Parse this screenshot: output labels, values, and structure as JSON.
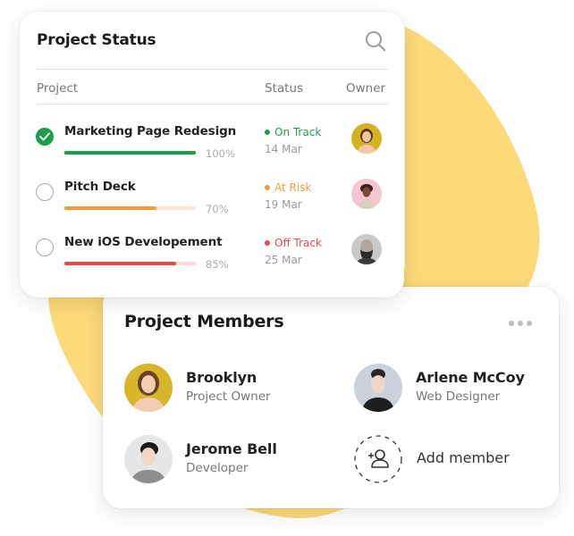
{
  "colors": {
    "blob": "#fcd979",
    "on_track": "#1e9e4a",
    "at_risk": "#f39a3e",
    "off_track": "#e8474d"
  },
  "status_card": {
    "title": "Project Status",
    "search_icon": "search-icon",
    "columns": {
      "project": "Project",
      "status": "Status",
      "owner": "Owner"
    },
    "rows": [
      {
        "name": "Marketing Page Redesign",
        "completed": true,
        "progress": 100,
        "progress_label": "100%",
        "status": "On Track",
        "status_key": "on_track",
        "date": "14 Mar",
        "owner_avatar": "avatar-woman-yellow-bg"
      },
      {
        "name": "Pitch Deck",
        "completed": false,
        "progress": 70,
        "progress_label": "70%",
        "status": "At Risk",
        "status_key": "at_risk",
        "date": "19 Mar",
        "owner_avatar": "avatar-woman-pink-bg"
      },
      {
        "name": "New iOS Developement",
        "completed": false,
        "progress": 85,
        "progress_label": "85%",
        "status": "Off Track",
        "status_key": "off_track",
        "date": "25 Mar",
        "owner_avatar": "avatar-bearded-man"
      }
    ]
  },
  "members_card": {
    "title": "Project Members",
    "more_icon": "more-horizontal-icon",
    "members": [
      {
        "name": "Brooklyn",
        "role": "Project Owner",
        "avatar": "avatar-woman-yellow-bg"
      },
      {
        "name": "Arlene McCoy",
        "role": "Web Designer",
        "avatar": "avatar-woman-grey-bg"
      },
      {
        "name": "Jerome Bell",
        "role": "Developer",
        "avatar": "avatar-man-grey-bg"
      }
    ],
    "add_member_label": "Add member"
  }
}
